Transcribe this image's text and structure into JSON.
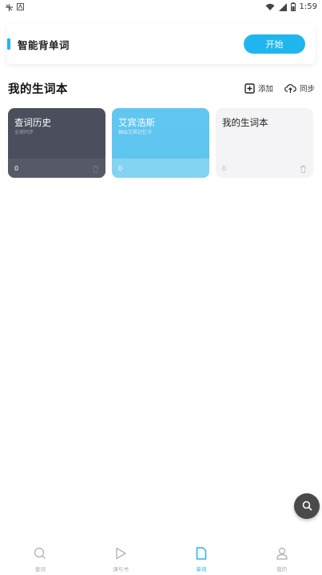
{
  "status_bar": {
    "time": "1:59",
    "left_icons": [
      "app-notification-icon",
      "text-icon"
    ],
    "right_icons": [
      "wifi-icon",
      "signal-icon",
      "battery-icon"
    ]
  },
  "top_card": {
    "title": "智能背单词",
    "start_label": "开始"
  },
  "section": {
    "title": "我的生词本",
    "add_label": "添加",
    "sync_label": "同步"
  },
  "cards": [
    {
      "title": "查词历史",
      "subtitle": "全部同步",
      "count": "0"
    },
    {
      "title": "艾宾浩斯",
      "subtitle": "抽出艾宾记忆卡",
      "count": "0"
    },
    {
      "title": "我的生词本",
      "subtitle": "",
      "count": "0"
    }
  ],
  "bottom_nav": {
    "items": [
      {
        "label": "查词",
        "icon": "search-icon"
      },
      {
        "label": "课与书",
        "icon": "play-icon"
      },
      {
        "label": "单词",
        "icon": "document-icon"
      },
      {
        "label": "我的",
        "icon": "person-icon"
      }
    ],
    "active": "单词"
  },
  "colors": {
    "accent": "#1fb6f0",
    "history_card": "#4b4f5d",
    "ebbing_card": "#5ec4ee",
    "mine_card": "#f4f4f6"
  }
}
